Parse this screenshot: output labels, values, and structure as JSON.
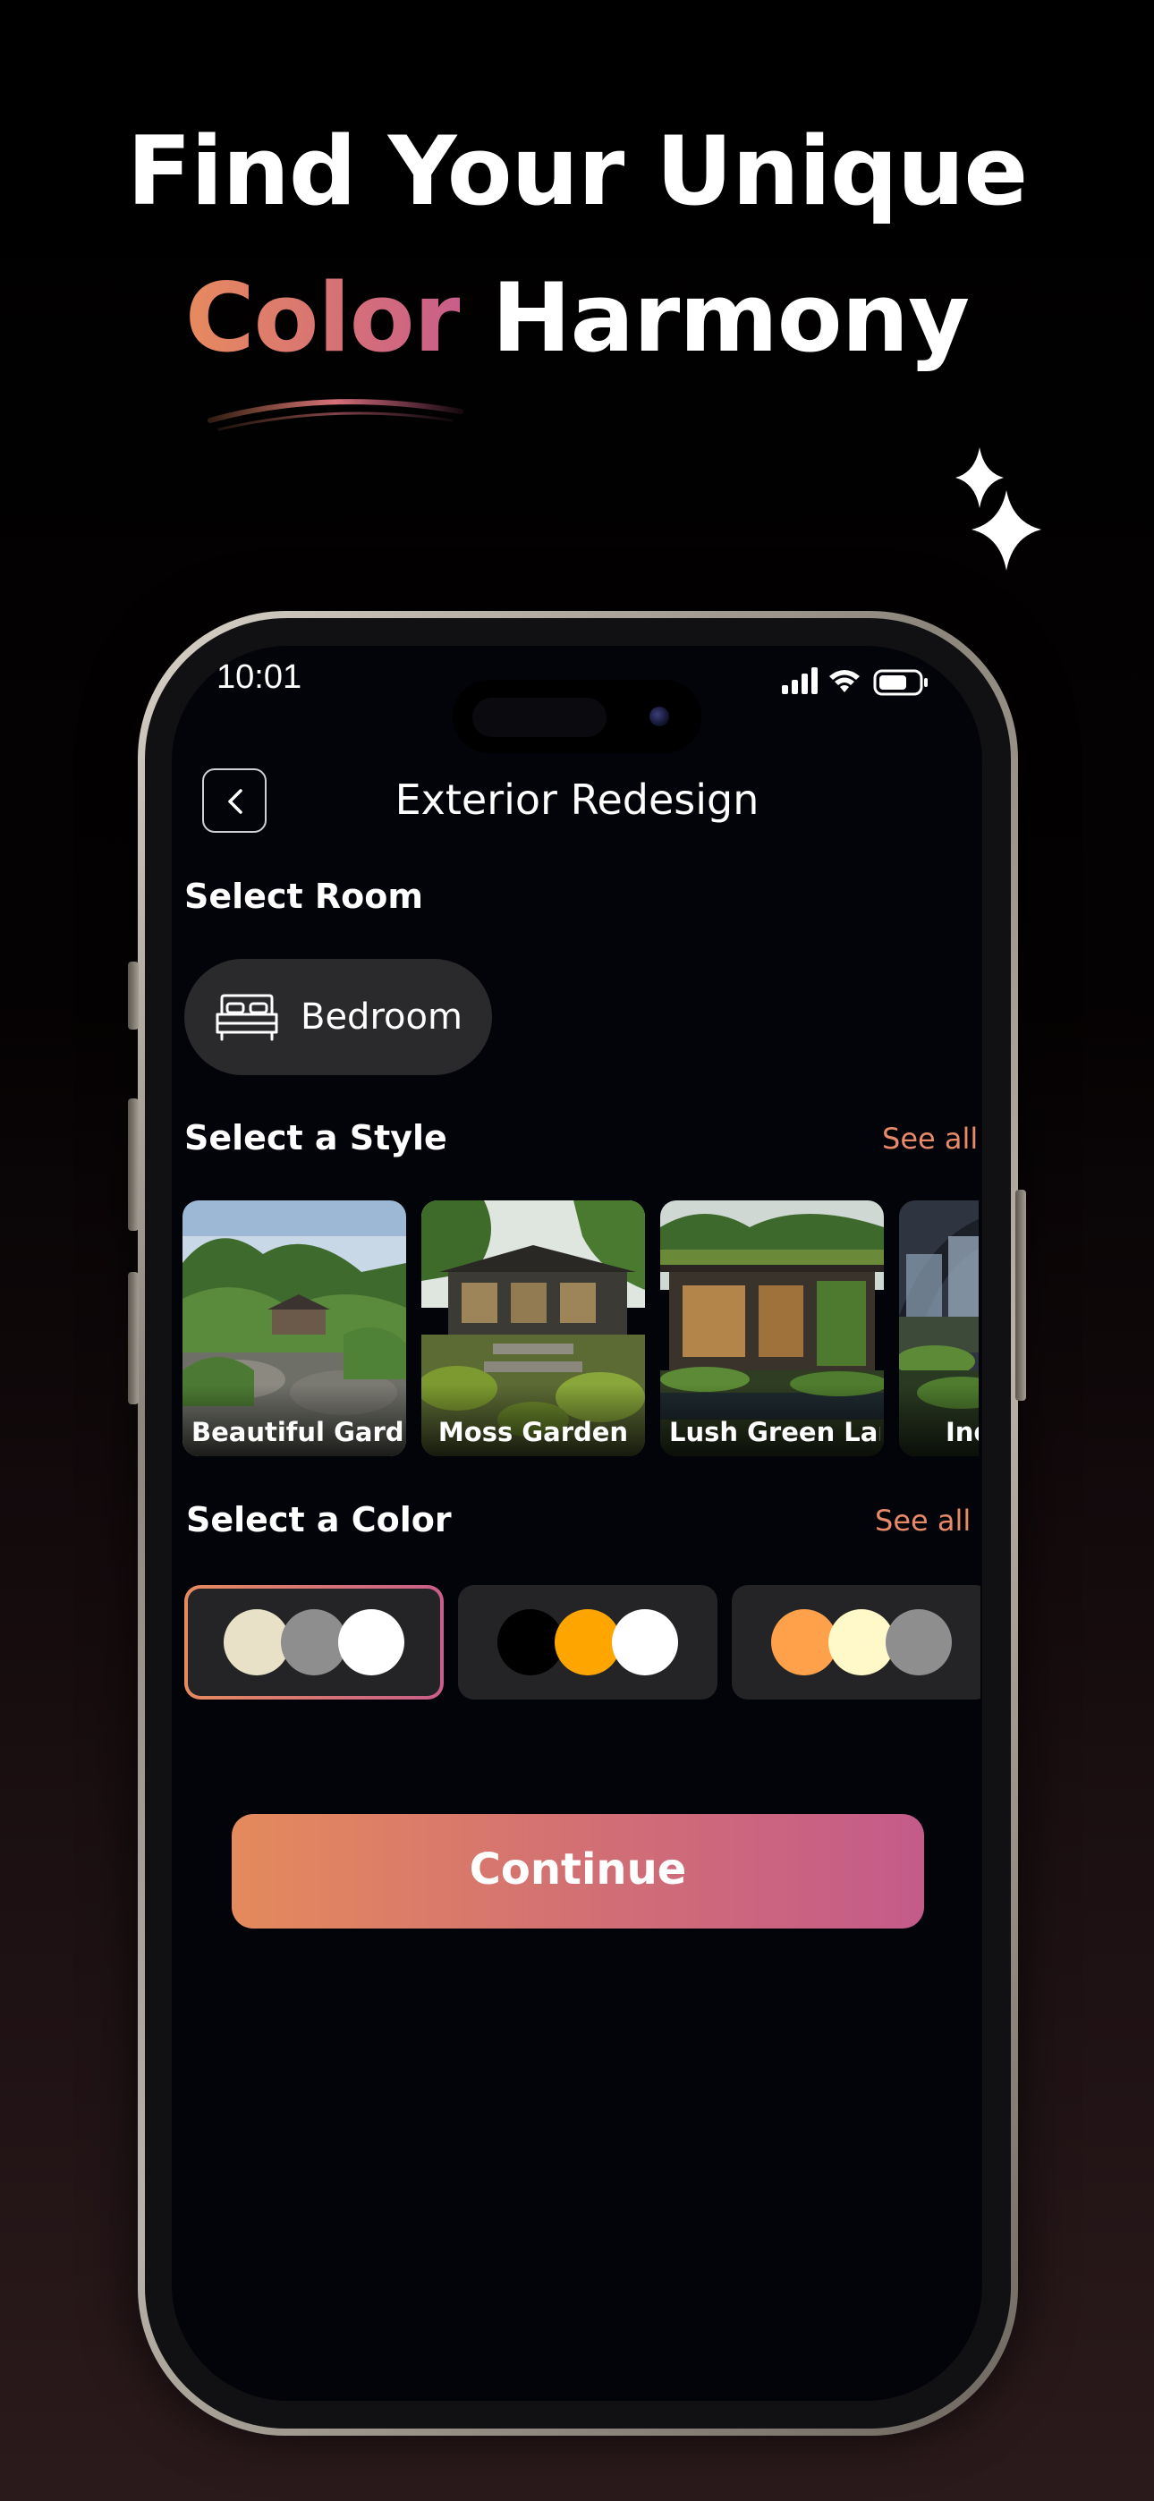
{
  "marketing": {
    "headline_line1": "Find Your Unique",
    "headline_accent": "Color",
    "headline_rest": "Harmony"
  },
  "status_bar": {
    "time": "10:01"
  },
  "header": {
    "title": "Exterior Redesign"
  },
  "room_section": {
    "label": "Select Room",
    "selected_room": "Bedroom",
    "icon": "bed-icon"
  },
  "style_section": {
    "label": "Select a Style",
    "see_all": "See all",
    "styles": [
      {
        "label": "Beautiful Gard.."
      },
      {
        "label": "Moss Garden"
      },
      {
        "label": "Lush Green Lan"
      },
      {
        "label": "Ind"
      }
    ]
  },
  "color_section": {
    "label": "Select a Color",
    "see_all": "See all",
    "palettes": [
      {
        "selected": true,
        "colors": [
          "#e8e1c8",
          "#8e8e8e",
          "#ffffff"
        ]
      },
      {
        "selected": false,
        "colors": [
          "#000000",
          "#ffa500",
          "#ffffff"
        ]
      },
      {
        "selected": false,
        "colors": [
          "#ffa04a",
          "#fff8c8",
          "#8e8e8e"
        ]
      }
    ]
  },
  "actions": {
    "continue_label": "Continue"
  },
  "theme": {
    "accent_start": "#e78a5e",
    "accent_end": "#c95e8a",
    "background": "#03030a",
    "card": "#242426"
  }
}
